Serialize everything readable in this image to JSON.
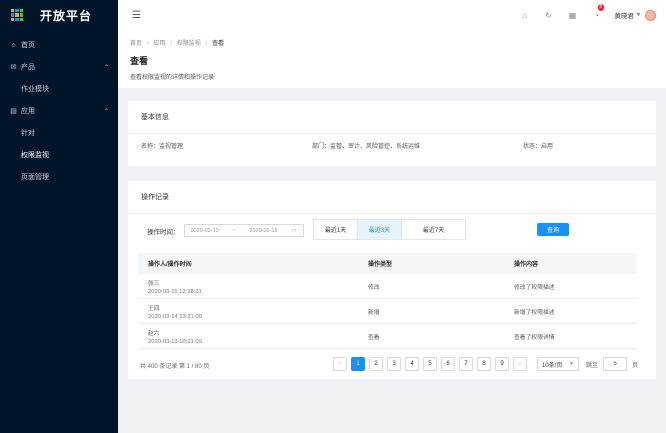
{
  "app": {
    "title": "开放平台"
  },
  "sidebar": {
    "items": [
      {
        "label": "首页",
        "icon": "home-icon"
      },
      {
        "label": "产品",
        "icon": "mail-icon",
        "expanded": true
      },
      {
        "label": "作业模块",
        "sub": true
      },
      {
        "label": "应用",
        "icon": "file-icon",
        "expanded": true
      },
      {
        "label": "针对",
        "sub": true
      },
      {
        "label": "权限监视",
        "sub": true,
        "active": true
      },
      {
        "label": "页面管理",
        "sub": true
      }
    ]
  },
  "topbar": {
    "username": "黄晓君",
    "notification_count": "8"
  },
  "breadcrumb": [
    "首页",
    "应用",
    "权限监视",
    "查看"
  ],
  "page": {
    "title": "查看",
    "description": "查看权限监视的详情和操作记录"
  },
  "basic": {
    "title": "基本信息",
    "name": "名称：监视管理",
    "dept": "部门：监管、审计、风险管控、系统运维",
    "status": "状态：启用"
  },
  "records": {
    "title": "操作记录",
    "time_label": "操作时间：",
    "date_start": "2020-02-10",
    "date_sep": "~",
    "date_end": "2020-02-15",
    "segments": [
      "最近1天",
      "最近3天",
      "最近7天"
    ],
    "active_segment": 1,
    "query_label": "查询",
    "columns": [
      "操作人/操作时间",
      "操作类型",
      "操作内容"
    ],
    "rows": [
      {
        "user": "张三",
        "time": "2020-03-15 12:28:21",
        "type": "修改",
        "content": "修改了权限描述"
      },
      {
        "user": "王四",
        "time": "2020-03-14 13:21:00",
        "type": "新增",
        "content": "新增了权限描述"
      },
      {
        "user": "赵六",
        "time": "2020-03-13 10:21:09",
        "type": "查看",
        "content": "查看了权限详情"
      }
    ],
    "total_text": "共 400 条记录 第 1 / 80 页",
    "pages": [
      "1",
      "2",
      "3",
      "4",
      "5",
      "6",
      "7",
      "8",
      "9"
    ],
    "current_page": "1",
    "page_size": "10条/页",
    "jump_label": "跳至",
    "jump_value": "5",
    "jump_suffix": "页"
  },
  "colors": {
    "sidebar": "#001529",
    "accent": "#1890ff",
    "badge": "#f5222d"
  }
}
